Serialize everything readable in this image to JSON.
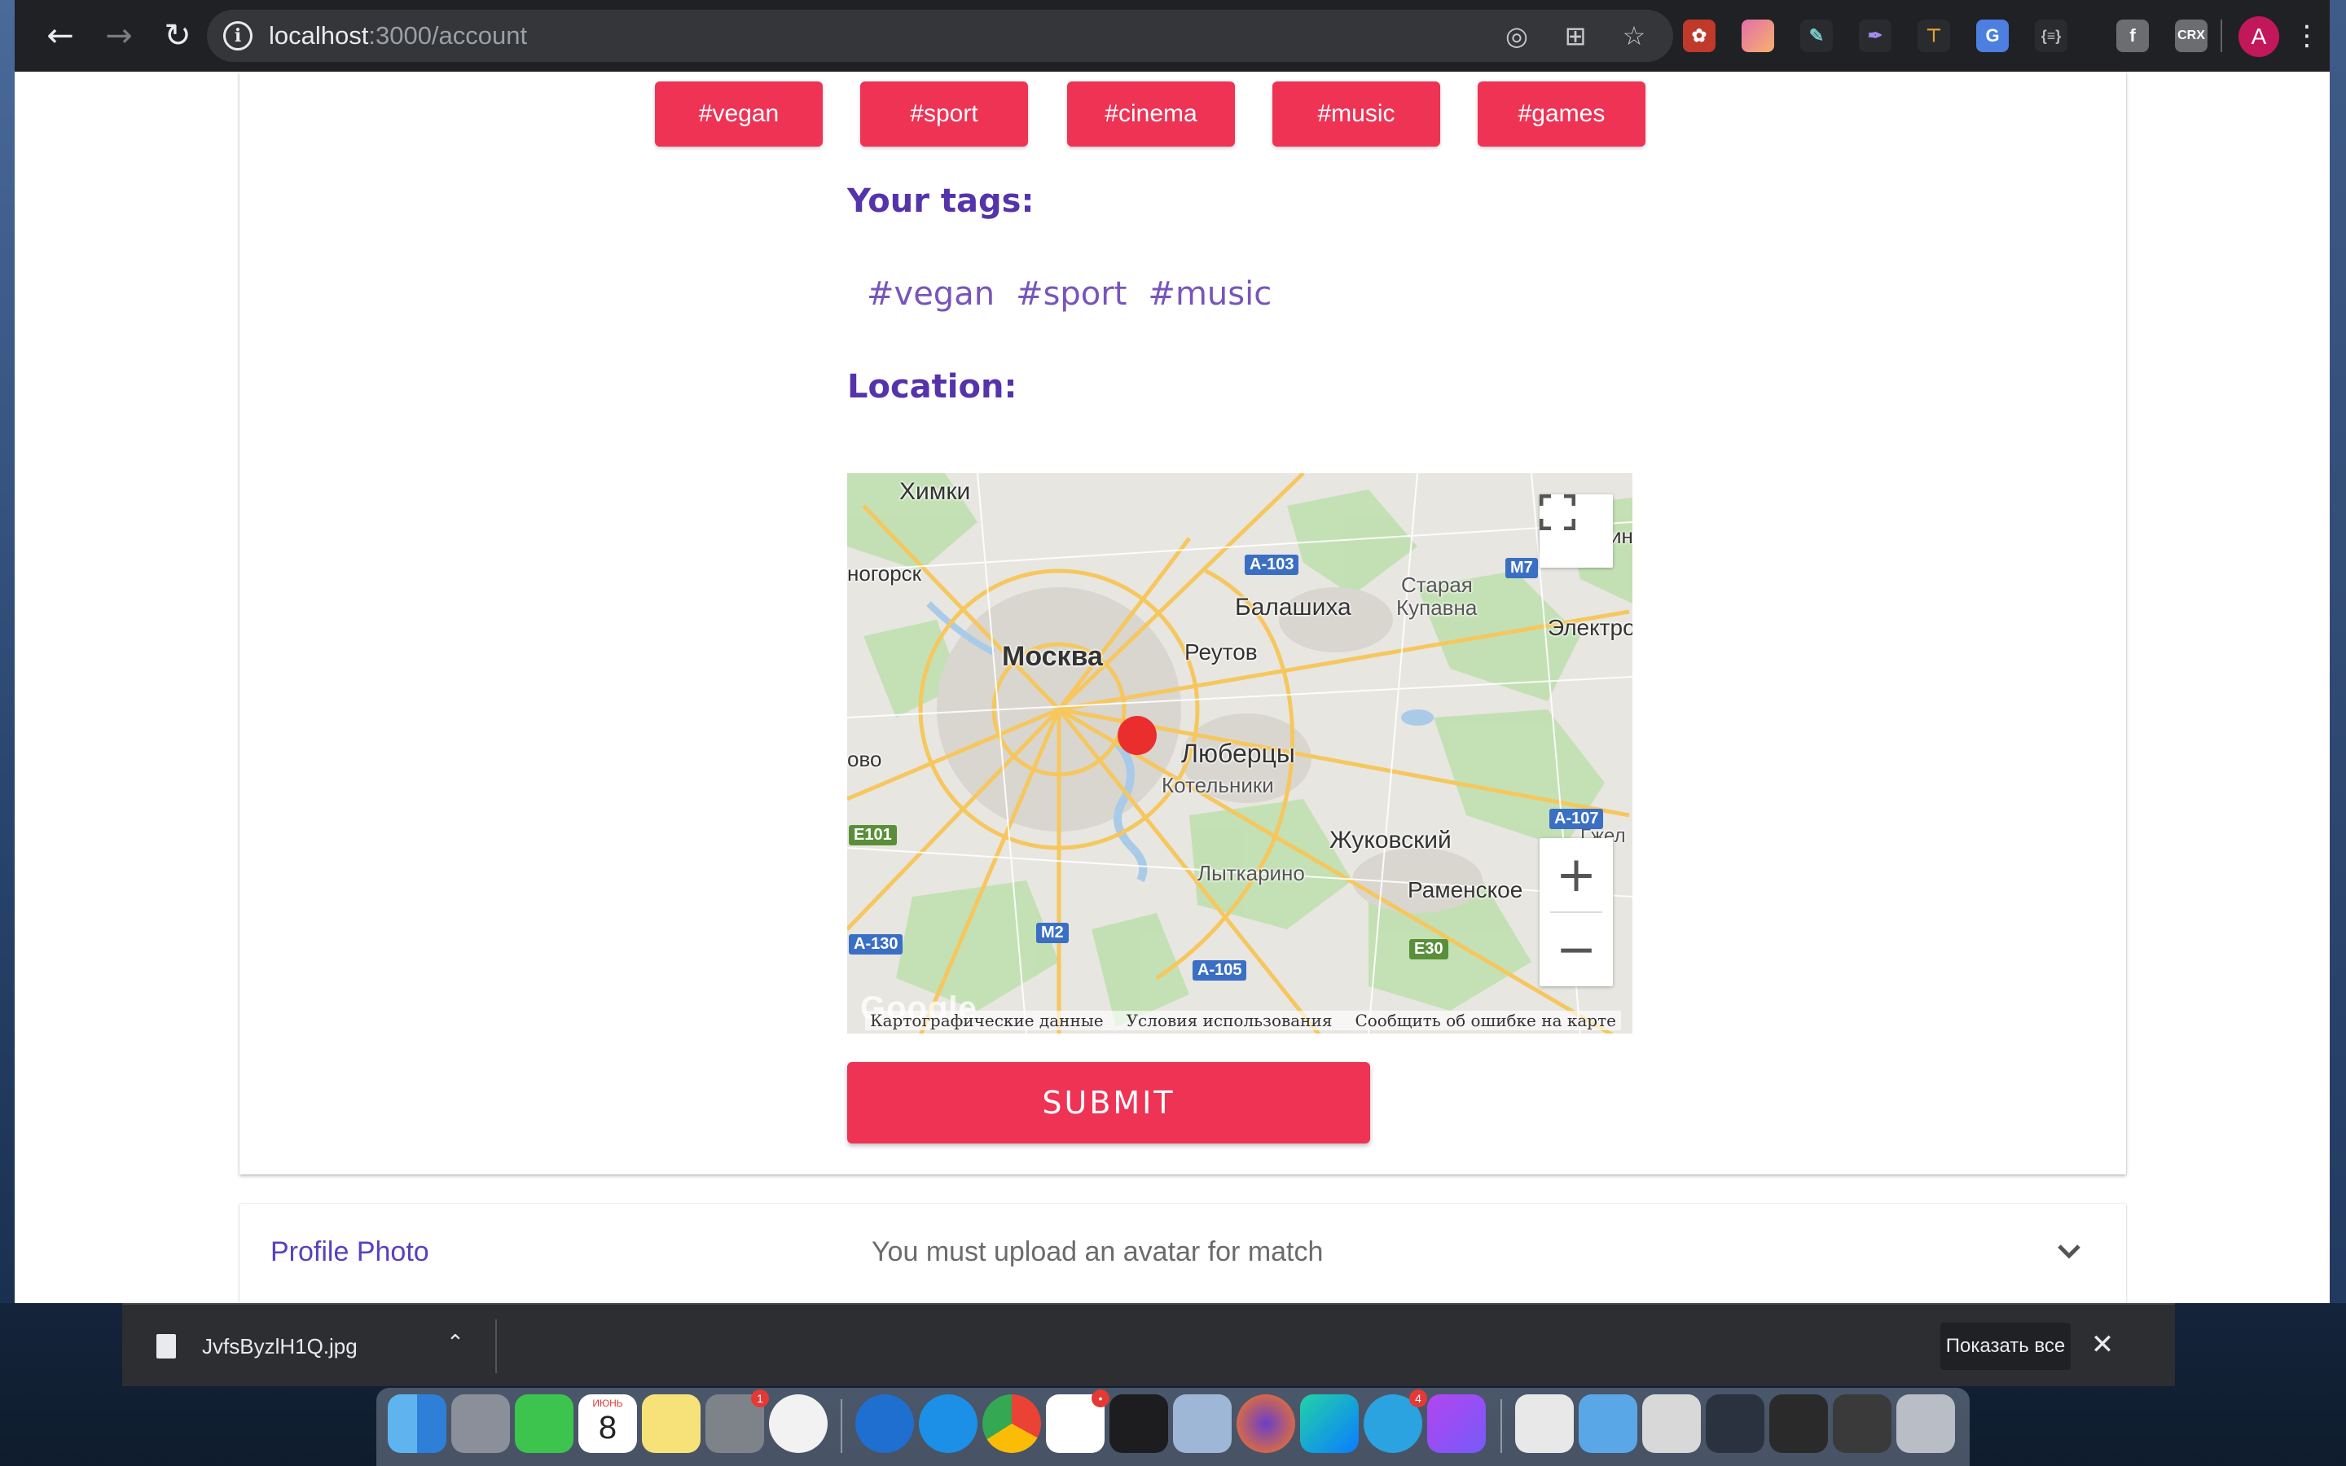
{
  "browser": {
    "url_host": "localhost",
    "url_path": ":3000/account",
    "avatar_letter": "A",
    "extensions": [
      "ext-1",
      "ext-2",
      "ext-3",
      "ext-4",
      "ext-5",
      "ext-6",
      "ext-7",
      "f",
      "CRX"
    ]
  },
  "interests": {
    "chips": [
      "#vegan",
      "#sport",
      "#cinema",
      "#music",
      "#games"
    ]
  },
  "your_tags": {
    "heading": "Your tags:",
    "tags": [
      "#vegan",
      "#sport",
      "#music"
    ]
  },
  "location": {
    "heading": "Location:",
    "map": {
      "places": {
        "khimki": "Химки",
        "gorsk": "ногорск",
        "moskva": "Москва",
        "balashikha": "Балашиха",
        "staraya": "Старая",
        "kupavna": "Купавна",
        "reutov": "Реутов",
        "elektro": "Электро",
        "lyubertsy": "Люберцы",
        "kotelniki": "Котельники",
        "ovo": "ово",
        "zhukovsky": "Жуковский",
        "lytkarino": "Лыткарино",
        "ramenskoe": "Раменское",
        "gzhel": "Гжел",
        "in": "ин"
      },
      "shields": {
        "a103": "A-103",
        "m7": "M7",
        "a107": "A-107",
        "e101": "E101",
        "a130": "A-130",
        "m2": "M2",
        "a105": "A-105",
        "e30": "E30"
      },
      "footer": {
        "logo": "Google",
        "map_data": "Картографические данные",
        "terms": "Условия использования",
        "report": "Сообщить об ошибке на карте"
      },
      "zoom_in": "+",
      "zoom_out": "−"
    }
  },
  "submit_label": "SUBMIT",
  "profile_photo": {
    "title": "Profile Photo",
    "subtitle": "You must upload an avatar for match"
  },
  "downloads": {
    "file_name": "JvfsByzlH1Q.jpg",
    "show_all": "Показать все"
  },
  "dock": {
    "calendar_month": "ИЮНЬ",
    "calendar_day": "8",
    "badges": {
      "settings": "1",
      "slack": "•",
      "telegram": "4"
    }
  }
}
